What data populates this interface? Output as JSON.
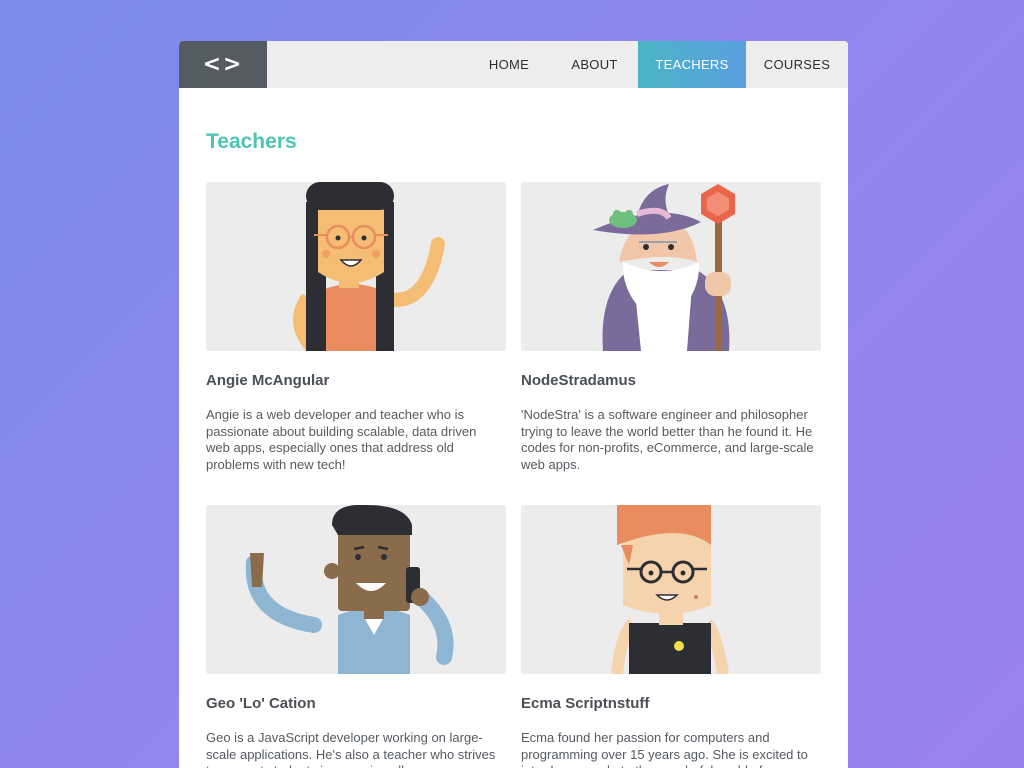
{
  "nav": {
    "logo_icon": "code-brackets-icon",
    "logo_glyph": "<>",
    "items": [
      {
        "label": "HOME",
        "active": false
      },
      {
        "label": "ABOUT",
        "active": false
      },
      {
        "label": "TEACHERS",
        "active": true
      },
      {
        "label": "COURSES",
        "active": false
      }
    ]
  },
  "page": {
    "title": "Teachers",
    "title_color": "#4fc3b4"
  },
  "teachers": [
    {
      "name": "Angie McAngular",
      "bio": "Angie is a web developer and teacher who is passionate about building scalable, data driven web apps, especially ones that address old problems with new tech!"
    },
    {
      "name": "NodeStradamus",
      "bio": "'NodeStra' is a software engineer and philosopher trying to leave the world better than he found it. He codes for non-profits, eCommerce, and large-scale web apps."
    },
    {
      "name": "Geo 'Lo' Cation",
      "bio": "Geo is a JavaScript developer working on large-scale applications. He's also a teacher who strives to support students in removing all"
    },
    {
      "name": "Ecma Scriptnstuff",
      "bio": "Ecma found her passion for computers and programming over 15 years ago. She is excited to introduce people to the wonderful world of"
    }
  ],
  "colors": {
    "accent_teal": "#4fc3b4",
    "active_tab_start": "#4cb4c6",
    "active_tab_end": "#5a9fe0",
    "logo_bg": "#545b63"
  }
}
